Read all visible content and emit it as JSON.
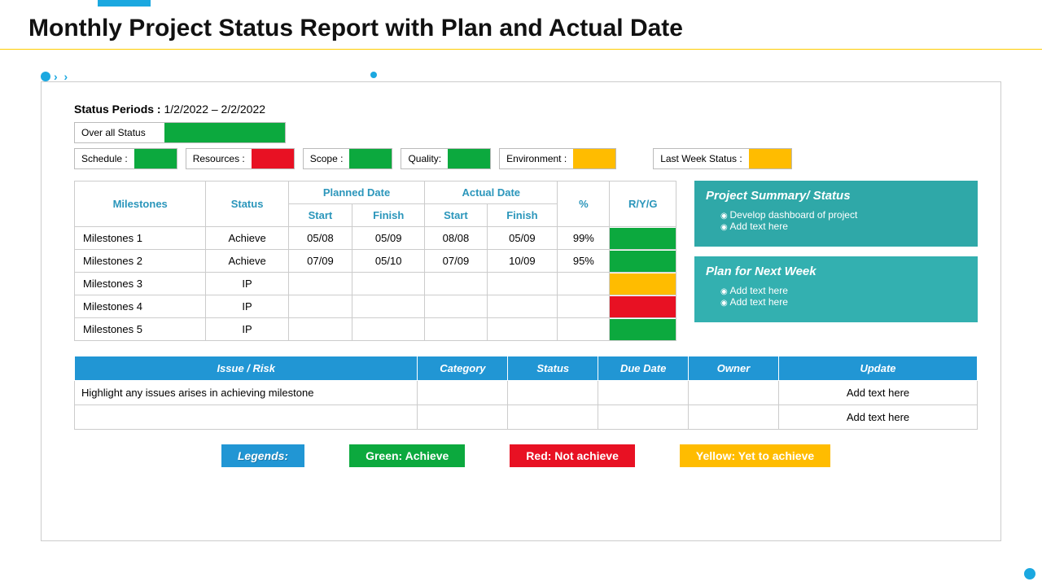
{
  "title": "Monthly Project Status Report with Plan and Actual Date",
  "statusPeriod": {
    "label": "Status Periods :",
    "value": " 1/2/2022 – 2/2/2022"
  },
  "overall": {
    "label": "Over all Status",
    "color": "green"
  },
  "metrics": [
    {
      "label": "Schedule :",
      "color": "green"
    },
    {
      "label": "Resources :",
      "color": "red"
    },
    {
      "label": "Scope :",
      "color": "green"
    },
    {
      "label": "Quality:",
      "color": "green"
    },
    {
      "label": "Environment :",
      "color": "yellow"
    },
    {
      "label": "Last Week Status :",
      "color": "yellow",
      "wide": true
    }
  ],
  "mileHeaders": {
    "planned": "Planned Date",
    "actual": "Actual Date",
    "milestones": "Milestones",
    "status": "Status",
    "start": "Start",
    "finish": "Finish",
    "pct": "%",
    "ryg": "R/Y/G"
  },
  "milestones": [
    {
      "name": "Milestones 1",
      "status": "Achieve",
      "ps": "05/08",
      "pf": "05/09",
      "as": "08/08",
      "af": "05/09",
      "pct": "99%",
      "ryg": "green"
    },
    {
      "name": "Milestones 2",
      "status": "Achieve",
      "ps": "07/09",
      "pf": "05/10",
      "as": "07/09",
      "af": "10/09",
      "pct": "95%",
      "ryg": "green"
    },
    {
      "name": "Milestones 3",
      "status": "IP",
      "ps": "",
      "pf": "",
      "as": "",
      "af": "",
      "pct": "",
      "ryg": "yellow"
    },
    {
      "name": "Milestones 4",
      "status": "IP",
      "ps": "",
      "pf": "",
      "as": "",
      "af": "",
      "pct": "",
      "ryg": "red"
    },
    {
      "name": "Milestones 5",
      "status": "IP",
      "ps": "",
      "pf": "",
      "as": "",
      "af": "",
      "pct": "",
      "ryg": "green"
    }
  ],
  "summary": {
    "title": "Project  Summary/ Status",
    "items": [
      "Develop  dashboard  of project",
      "Add text here"
    ]
  },
  "nextWeek": {
    "title": "Plan for Next Week",
    "items": [
      "Add text here",
      "Add text here"
    ]
  },
  "issueHeaders": [
    "Issue / Risk",
    "Category",
    "Status",
    "Due Date",
    "Owner",
    "Update"
  ],
  "issues": [
    {
      "text": "Highlight any issues arises in achieving milestone",
      "update": "Add text here"
    },
    {
      "text": "",
      "update": "Add text here"
    }
  ],
  "legends": {
    "title": "Legends:",
    "green": "Green: Achieve",
    "red": "Red: Not achieve",
    "yellow": "Yellow: Yet to achieve"
  }
}
